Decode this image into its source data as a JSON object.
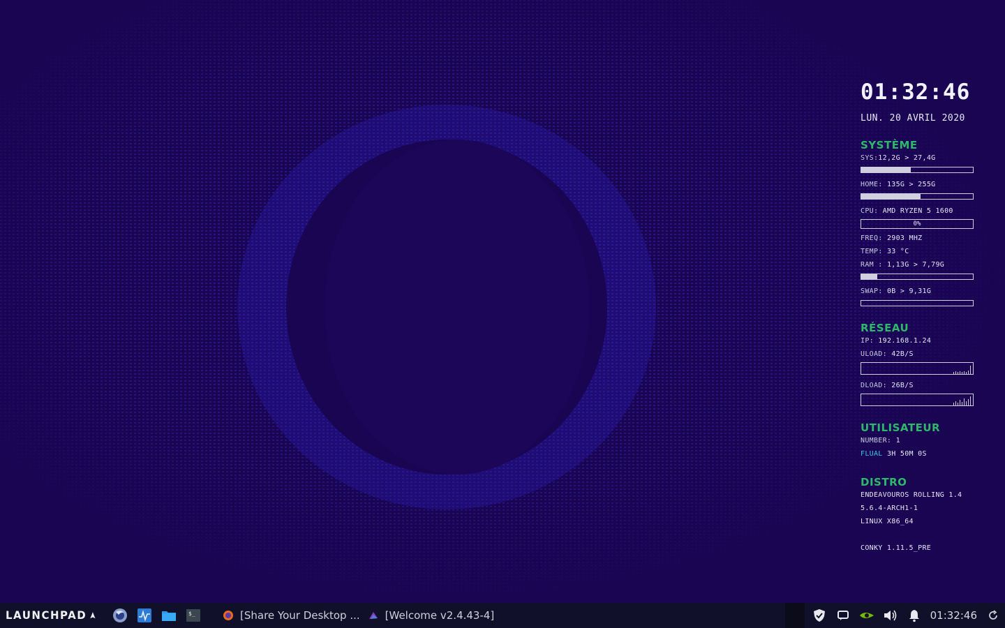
{
  "conky": {
    "time": "01:32:46",
    "date": "LUN. 20 AVRIL 2020",
    "sections": {
      "system": "SYSTÈME",
      "network": "RÉSEAU",
      "user": "UTILISATEUR",
      "distro": "DISTRO"
    },
    "sys": {
      "label": "SYS:",
      "value": "12,2G > 27,4G",
      "usage": 0.445
    },
    "home": {
      "label": "HOME:",
      "value": "135G > 255G",
      "usage": 0.53
    },
    "cpu": {
      "label": "CPU:",
      "value": "AMD RYZEN 5 1600",
      "percent_text": "0%"
    },
    "freq": {
      "label": "FREQ:",
      "value": "2903 MHZ"
    },
    "temp": {
      "label": "TEMP:",
      "value": "33 °C"
    },
    "ram": {
      "label": "RAM :",
      "value": "1,13G > 7,79G",
      "usage": 0.145
    },
    "swap": {
      "label": "SWAP:",
      "value": "0B > 9,31G",
      "usage": 0
    },
    "ip": {
      "label": "IP:",
      "value": "192.168.1.24"
    },
    "upload": {
      "label": "ULOAD:",
      "value": "42B/S"
    },
    "download": {
      "label": "DLOAD:",
      "value": "26B/S"
    },
    "number": {
      "label": "NUMBER:",
      "value": "1"
    },
    "session": {
      "user": "FLUAL",
      "uptime": "3H 50M 0S"
    },
    "distro_lines": [
      "ENDEAVOUROS ROLLING 1.4",
      "5.6.4-ARCH1-1",
      "LINUX X86_64"
    ],
    "conky_version": "CONKY 1.11.5_PRE"
  },
  "taskbar": {
    "launcher_label": "LAUNCHPAD",
    "quick_launch": [
      "firefox-icon",
      "system-monitor-icon",
      "files-icon",
      "terminal-icon"
    ],
    "tasks": [
      {
        "icon": "firefox-icon",
        "label": "[Share Your Desktop ..."
      },
      {
        "icon": "endeavouros-icon",
        "label": "[Welcome v2.4.43-4]"
      }
    ],
    "tray_icons": [
      "shield-icon",
      "chat-icon",
      "nvidia-icon",
      "volume-icon",
      "bell-icon",
      "refresh-icon"
    ],
    "clock": "01:32:46"
  },
  "colors": {
    "background": "#1a0553",
    "accent_green": "#2fb86a",
    "highlight_cyan": "#3fc7e0",
    "taskbar": "#11102a"
  }
}
